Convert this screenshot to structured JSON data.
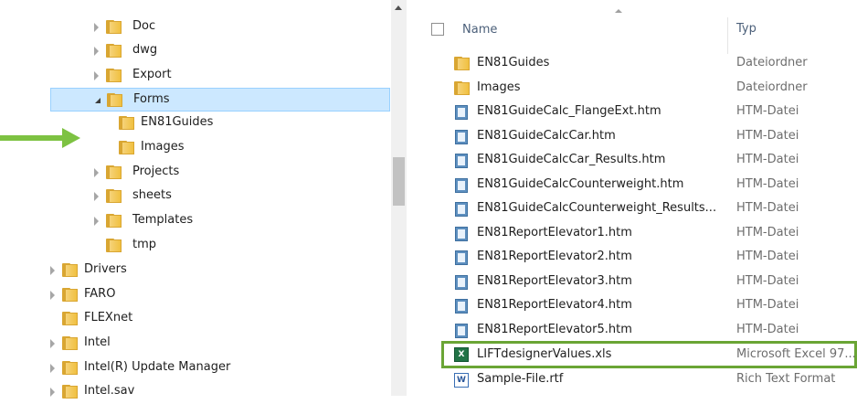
{
  "tree": {
    "items": [
      {
        "label": "Doc",
        "chevron": "collapsed"
      },
      {
        "label": "dwg",
        "chevron": "collapsed"
      },
      {
        "label": "Export",
        "chevron": "collapsed"
      },
      {
        "label": "Forms",
        "chevron": "expanded",
        "selected": true
      },
      {
        "label": "EN81Guides",
        "chevron": "none"
      },
      {
        "label": "Images",
        "chevron": "none"
      },
      {
        "label": "Projects",
        "chevron": "collapsed"
      },
      {
        "label": "sheets",
        "chevron": "collapsed"
      },
      {
        "label": "Templates",
        "chevron": "collapsed"
      },
      {
        "label": "tmp",
        "chevron": "none"
      },
      {
        "label": "Drivers",
        "chevron": "collapsed"
      },
      {
        "label": "FARO",
        "chevron": "collapsed"
      },
      {
        "label": "FLEXnet",
        "chevron": "none"
      },
      {
        "label": "Intel",
        "chevron": "collapsed"
      },
      {
        "label": "Intel(R) Update Manager",
        "chevron": "collapsed"
      },
      {
        "label": "Intel.sav",
        "chevron": "collapsed"
      }
    ]
  },
  "annotation": {
    "arrow_color": "#7dc242"
  },
  "list": {
    "header": {
      "name": "Name",
      "type": "Typ"
    },
    "files": [
      {
        "name": "EN81Guides",
        "type": "Dateiordner",
        "icon": "folder-icon"
      },
      {
        "name": "Images",
        "type": "Dateiordner",
        "icon": "folder-icon"
      },
      {
        "name": "EN81GuideCalc_FlangeExt.htm",
        "type": "HTM-Datei",
        "icon": "htm-file-icon"
      },
      {
        "name": "EN81GuideCalcCar.htm",
        "type": "HTM-Datei",
        "icon": "htm-file-icon"
      },
      {
        "name": "EN81GuideCalcCar_Results.htm",
        "type": "HTM-Datei",
        "icon": "htm-file-icon"
      },
      {
        "name": "EN81GuideCalcCounterweight.htm",
        "type": "HTM-Datei",
        "icon": "htm-file-icon"
      },
      {
        "name": "EN81GuideCalcCounterweight_Results...",
        "type": "HTM-Datei",
        "icon": "htm-file-icon"
      },
      {
        "name": "EN81ReportElevator1.htm",
        "type": "HTM-Datei",
        "icon": "htm-file-icon"
      },
      {
        "name": "EN81ReportElevator2.htm",
        "type": "HTM-Datei",
        "icon": "htm-file-icon"
      },
      {
        "name": "EN81ReportElevator3.htm",
        "type": "HTM-Datei",
        "icon": "htm-file-icon"
      },
      {
        "name": "EN81ReportElevator4.htm",
        "type": "HTM-Datei",
        "icon": "htm-file-icon"
      },
      {
        "name": "EN81ReportElevator5.htm",
        "type": "HTM-Datei",
        "icon": "htm-file-icon"
      },
      {
        "name": "LIFTdesignerValues.xls",
        "type": "Microsoft Excel 97...",
        "icon": "excel-file-icon",
        "highlighted": true,
        "highlight_color": "#6aa535"
      },
      {
        "name": "Sample-File.rtf",
        "type": "Rich Text Format",
        "icon": "rtf-file-icon"
      }
    ]
  }
}
